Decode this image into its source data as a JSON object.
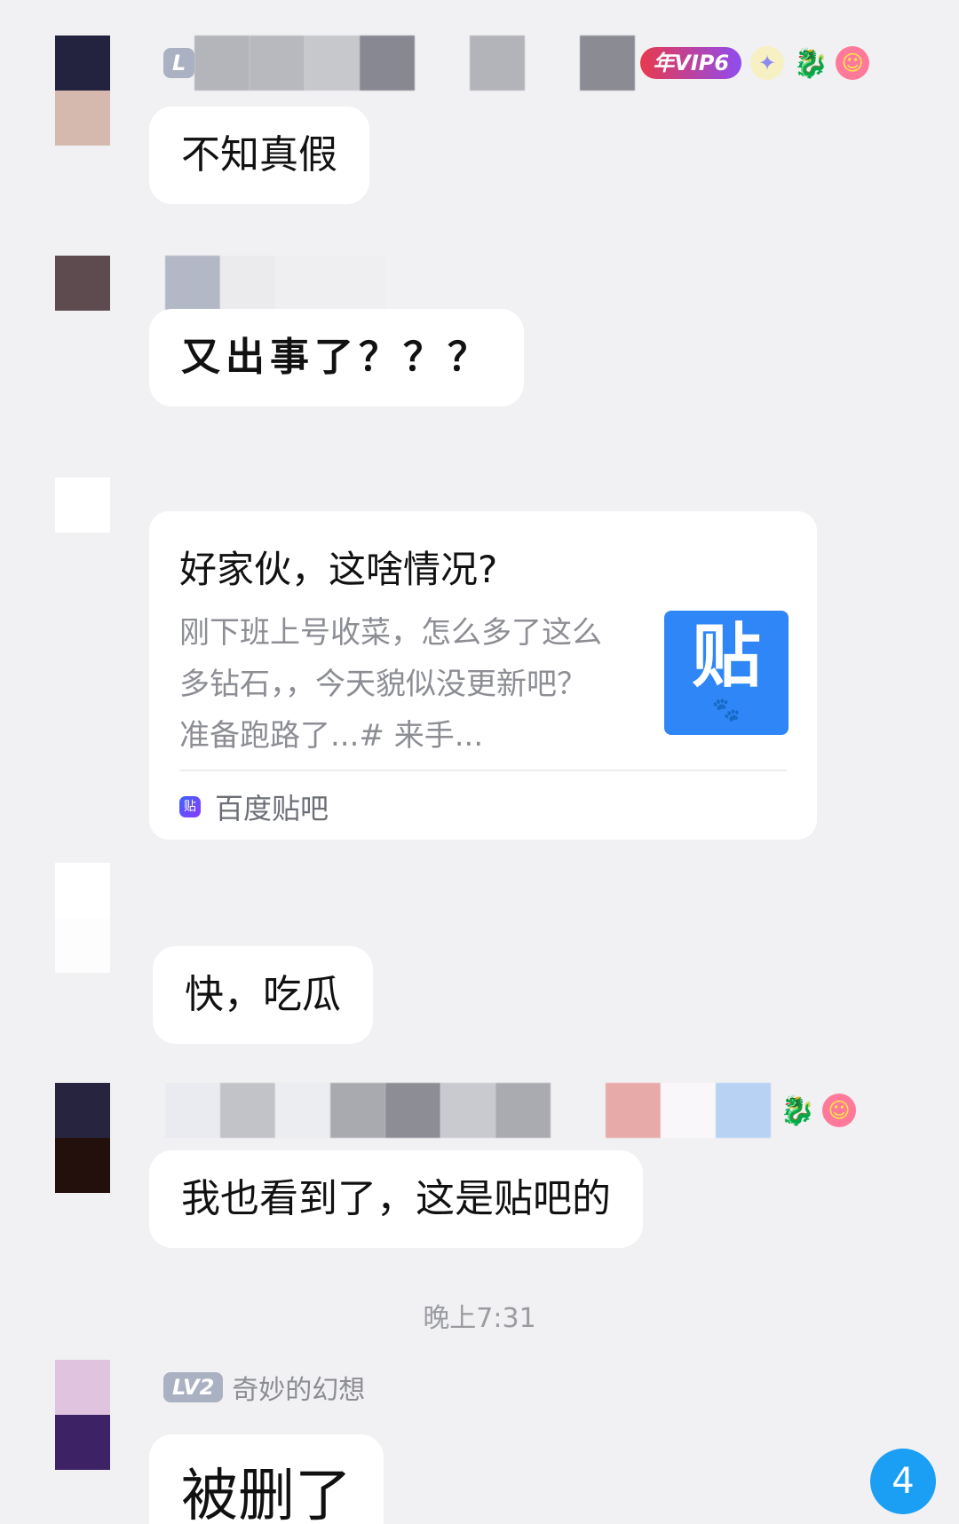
{
  "messages": [
    {
      "text": "不知真假"
    },
    {
      "text": "又出事了？？？"
    },
    {
      "text": "快，吃瓜"
    },
    {
      "text": "我也看到了，这是贴吧的"
    },
    {
      "text": "被删了"
    }
  ],
  "shared_card": {
    "title": "好家伙，这啥情况?",
    "description": "刚下班上号收菜，怎么多了这么多钻石，，今天貌似没更新吧？ 准备跑路了...# 来手...",
    "thumb_glyph": "贴",
    "source_label": "百度贴吧",
    "source_icon_glyph": "贴"
  },
  "badges": {
    "vip": "年VIP6",
    "level_1": "L",
    "level_2": "LV2"
  },
  "sender_name_last": "奇妙的幻想",
  "timestamp": "晚上7:31",
  "unread_count": "4",
  "colors": {
    "background": "#f1f1f3",
    "bubble": "#ffffff",
    "unread_badge": "#1a9ff5",
    "tieba_blue": "#2f86f6"
  },
  "icons": [
    "vip-badge",
    "gift-icon",
    "dragon-icon",
    "smile-icon",
    "paw-icon"
  ]
}
